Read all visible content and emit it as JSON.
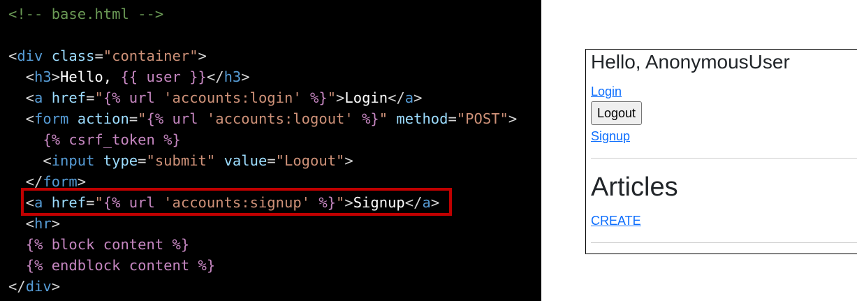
{
  "code_panel": {
    "lines": [
      {
        "parts": [
          {
            "t": "<!-- base.html -->",
            "c": "comment"
          }
        ]
      },
      {
        "parts": []
      },
      {
        "parts": [
          {
            "t": "<",
            "c": "punc"
          },
          {
            "t": "div",
            "c": "tag"
          },
          {
            "t": " class",
            "c": "attr"
          },
          {
            "t": "=",
            "c": "punc"
          },
          {
            "t": "\"container\"",
            "c": "str"
          },
          {
            "t": ">",
            "c": "punc"
          }
        ]
      },
      {
        "parts": [
          {
            "t": "  <",
            "c": "punc"
          },
          {
            "t": "h3",
            "c": "tag"
          },
          {
            "t": ">",
            "c": "punc"
          },
          {
            "t": "Hello, ",
            "c": "txt"
          },
          {
            "t": "{{ user }}",
            "c": "tpl"
          },
          {
            "t": "</",
            "c": "punc"
          },
          {
            "t": "h3",
            "c": "tag"
          },
          {
            "t": ">",
            "c": "punc"
          }
        ]
      },
      {
        "parts": [
          {
            "t": "  <",
            "c": "punc"
          },
          {
            "t": "a",
            "c": "tag"
          },
          {
            "t": " href",
            "c": "attr"
          },
          {
            "t": "=",
            "c": "punc"
          },
          {
            "t": "\"",
            "c": "str"
          },
          {
            "t": "{% url",
            "c": "tpl"
          },
          {
            "t": " 'accounts:login' ",
            "c": "str"
          },
          {
            "t": "%}",
            "c": "tpl"
          },
          {
            "t": "\"",
            "c": "str"
          },
          {
            "t": ">",
            "c": "punc"
          },
          {
            "t": "Login",
            "c": "txt"
          },
          {
            "t": "</",
            "c": "punc"
          },
          {
            "t": "a",
            "c": "tag"
          },
          {
            "t": ">",
            "c": "punc"
          }
        ]
      },
      {
        "parts": [
          {
            "t": "  <",
            "c": "punc"
          },
          {
            "t": "form",
            "c": "tag"
          },
          {
            "t": " action",
            "c": "attr"
          },
          {
            "t": "=",
            "c": "punc"
          },
          {
            "t": "\"",
            "c": "str"
          },
          {
            "t": "{% url",
            "c": "tpl"
          },
          {
            "t": " 'accounts:logout' ",
            "c": "str"
          },
          {
            "t": "%}",
            "c": "tpl"
          },
          {
            "t": "\"",
            "c": "str"
          },
          {
            "t": " method",
            "c": "attr"
          },
          {
            "t": "=",
            "c": "punc"
          },
          {
            "t": "\"POST\"",
            "c": "str"
          },
          {
            "t": ">",
            "c": "punc"
          }
        ]
      },
      {
        "parts": [
          {
            "t": "    ",
            "c": "txt"
          },
          {
            "t": "{% csrf_token %}",
            "c": "tpl"
          }
        ]
      },
      {
        "parts": [
          {
            "t": "    <",
            "c": "punc"
          },
          {
            "t": "input",
            "c": "tag"
          },
          {
            "t": " type",
            "c": "attr"
          },
          {
            "t": "=",
            "c": "punc"
          },
          {
            "t": "\"submit\"",
            "c": "str"
          },
          {
            "t": " value",
            "c": "attr"
          },
          {
            "t": "=",
            "c": "punc"
          },
          {
            "t": "\"Logout\"",
            "c": "str"
          },
          {
            "t": ">",
            "c": "punc"
          }
        ]
      },
      {
        "parts": [
          {
            "t": "  </",
            "c": "punc"
          },
          {
            "t": "form",
            "c": "tag"
          },
          {
            "t": ">",
            "c": "punc"
          }
        ]
      },
      {
        "parts": [
          {
            "t": "  <",
            "c": "punc"
          },
          {
            "t": "a",
            "c": "tag"
          },
          {
            "t": " href",
            "c": "attr"
          },
          {
            "t": "=",
            "c": "punc"
          },
          {
            "t": "\"",
            "c": "str"
          },
          {
            "t": "{% url",
            "c": "tpl"
          },
          {
            "t": " 'accounts:signup' ",
            "c": "str"
          },
          {
            "t": "%}",
            "c": "tpl"
          },
          {
            "t": "\"",
            "c": "str"
          },
          {
            "t": ">",
            "c": "punc"
          },
          {
            "t": "Signup",
            "c": "txt"
          },
          {
            "t": "</",
            "c": "punc"
          },
          {
            "t": "a",
            "c": "tag"
          },
          {
            "t": ">",
            "c": "punc"
          }
        ]
      },
      {
        "parts": [
          {
            "t": "  <",
            "c": "punc"
          },
          {
            "t": "hr",
            "c": "tag"
          },
          {
            "t": ">",
            "c": "punc"
          }
        ]
      },
      {
        "parts": [
          {
            "t": "  ",
            "c": "txt"
          },
          {
            "t": "{% block content %}",
            "c": "tpl"
          }
        ]
      },
      {
        "parts": [
          {
            "t": "  ",
            "c": "txt"
          },
          {
            "t": "{% endblock content %}",
            "c": "tpl"
          }
        ]
      },
      {
        "parts": [
          {
            "t": "</",
            "c": "punc"
          },
          {
            "t": "div",
            "c": "tag"
          },
          {
            "t": ">",
            "c": "punc"
          }
        ]
      }
    ],
    "highlight_color": "#c00000"
  },
  "preview": {
    "heading": "Hello, AnonymousUser",
    "login_link": "Login",
    "logout_button": "Logout",
    "signup_link": "Signup",
    "articles_heading": "Articles",
    "create_link": "CREATE",
    "link_color": "#0d6efd"
  }
}
